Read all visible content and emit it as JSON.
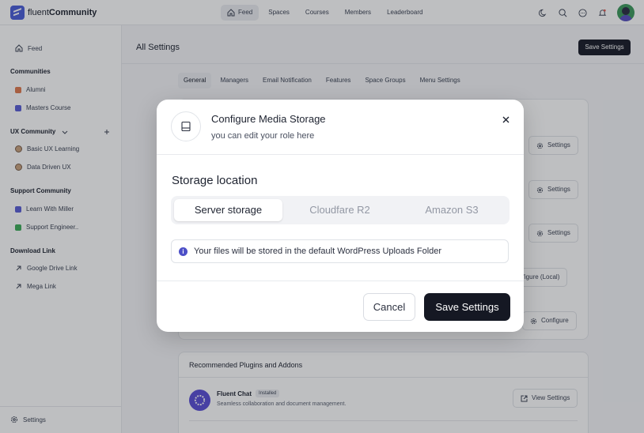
{
  "app": {
    "logo_light": "fluent",
    "logo_bold": "Community"
  },
  "topnav": {
    "items": [
      {
        "label": "Feed",
        "icon": "home-icon"
      },
      {
        "label": "Spaces"
      },
      {
        "label": "Courses"
      },
      {
        "label": "Members"
      },
      {
        "label": "Leaderboard"
      }
    ]
  },
  "sidebar": {
    "feed": "Feed",
    "communities_heading": "Communities",
    "communities": [
      {
        "label": "Alumni",
        "color": "#e07b4f"
      },
      {
        "label": "Masters Course",
        "color": "#5a5fd6"
      }
    ],
    "ux_heading": "UX Community",
    "ux_items": [
      {
        "label": "Basic UX Learning"
      },
      {
        "label": "Data Driven UX"
      }
    ],
    "support_heading": "Support Community",
    "support_items": [
      {
        "label": "Learn With Miller",
        "color": "#5a5fd6"
      },
      {
        "label": "Support Engineer..",
        "color": "#3fae5a"
      }
    ],
    "download_heading": "Download Link",
    "download_items": [
      {
        "label": "Google Drive Link"
      },
      {
        "label": "Mega Link"
      }
    ],
    "footer_settings": "Settings"
  },
  "main": {
    "title": "All Settings",
    "save_button": "Save Settings",
    "tabs": [
      "General",
      "Managers",
      "Email Notification",
      "Features",
      "Space Groups",
      "Menu Settings"
    ],
    "row_buttons": [
      "Settings",
      "Settings",
      "Settings",
      "Configure (Local)",
      "Configure"
    ],
    "plugins_title": "Recommended Plugins and Addons",
    "plugin": {
      "name": "Fluent Chat",
      "badge": "Installed",
      "description": "Seamless collaboration and document management.",
      "button": "View Settings"
    }
  },
  "modal": {
    "title": "Configure Media Storage",
    "subtitle": "you can edit your role here",
    "section_title": "Storage location",
    "options": [
      "Server storage",
      "Cloudfare R2",
      "Amazon S3"
    ],
    "selected_option": "Server storage",
    "info_text": "Your files will be stored in the default WordPress Uploads Folder",
    "cancel": "Cancel",
    "save": "Save Settings"
  },
  "colors": {
    "accent": "#4c5fd8",
    "primary_dark": "#151823",
    "info": "#4c4fc7"
  }
}
